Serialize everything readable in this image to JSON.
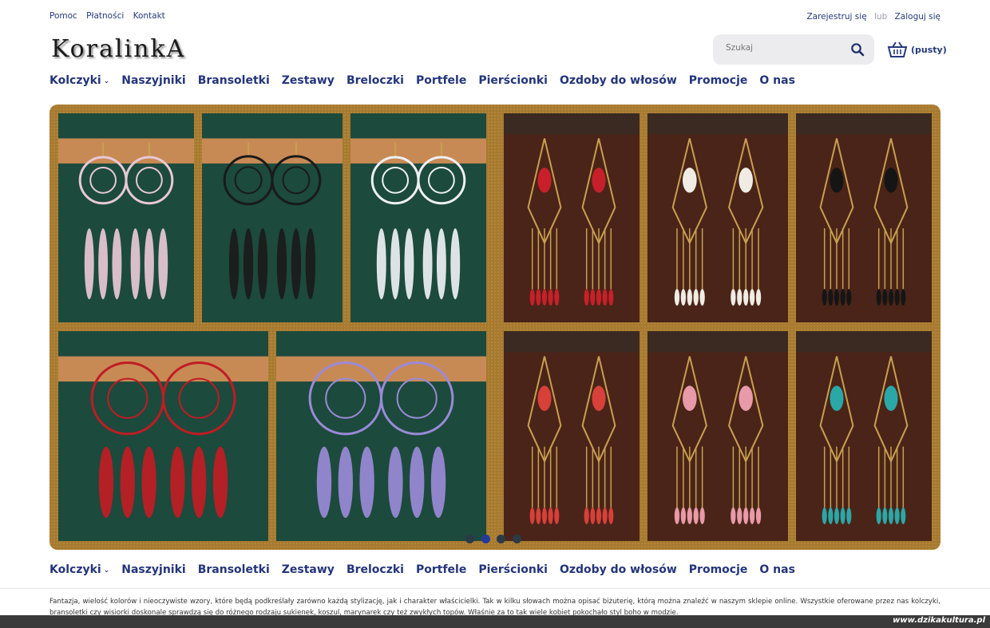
{
  "top_links": {
    "left": [
      "Pomoc",
      "Płatności",
      "Kontakt"
    ],
    "register": "Zarejestruj się",
    "or": "lub",
    "login": "Zaloguj się"
  },
  "logo": {
    "text": "KoralinkA"
  },
  "search": {
    "placeholder": "Szukaj",
    "icon": "search-icon"
  },
  "cart": {
    "label": "(pusty)",
    "icon": "basket-icon"
  },
  "nav": {
    "items": [
      "Kolczyki",
      "Naszyjniki",
      "Bransoletki",
      "Zestawy",
      "Breloczki",
      "Portfele",
      "Pierścionki",
      "Ozdoby do włosów",
      "Promocje",
      "O nas"
    ],
    "dropdown_icon": "chevron-down-icon"
  },
  "slider": {
    "tiles": [
      {
        "name": "dreamcatcher-earrings-pink",
        "color": "#e8c8d6",
        "bg": "#1c4a3c",
        "style": "dream"
      },
      {
        "name": "dreamcatcher-earrings-black",
        "color": "#1a1a1a",
        "bg": "#1c4a3c",
        "style": "dream"
      },
      {
        "name": "dreamcatcher-earrings-white",
        "color": "#eef0f4",
        "bg": "#1c4a3c",
        "style": "dream"
      },
      {
        "name": "chandelier-earrings-red",
        "color": "#c8202a",
        "bg": "#4a2418",
        "style": "chand"
      },
      {
        "name": "chandelier-earrings-white",
        "color": "#f0ece4",
        "bg": "#4a2418",
        "style": "chand"
      },
      {
        "name": "chandelier-earrings-black",
        "color": "#151515",
        "bg": "#4a2418",
        "style": "chand"
      },
      {
        "name": "dreamcatcher-earrings-red",
        "color": "#c01c24",
        "bg": "#1c4a3c",
        "style": "dream"
      },
      {
        "name": "dreamcatcher-earrings-purple",
        "color": "#9a8ad8",
        "bg": "#1c4a3c",
        "style": "dream"
      },
      {
        "name": "chandelier-earrings-multicolor",
        "color": "#d8403a",
        "bg": "#4a2418",
        "style": "chand"
      },
      {
        "name": "chandelier-earrings-pink",
        "color": "#e89aa8",
        "bg": "#4a2418",
        "style": "chand"
      },
      {
        "name": "chandelier-earrings-turquoise",
        "color": "#2aa8a8",
        "bg": "#4a2418",
        "style": "chand"
      }
    ],
    "dots": 4,
    "active_dot": 1
  },
  "description": "Fantazja, wielość kolorów i nieoczywiste wzory, które będą podkreślały zarówno każdą stylizację, jak i charakter właścicielki. Tak w kilku słowach można opisać biżuterię, którą można znaleźć w naszym sklepie online. Wszystkie oferowane przez nas kolczyki, bransoletki czy wisiorki doskonale sprawdzą się do różnego rodzaju sukienek, koszul, marynarek czy też zwykłych topów. Właśnie za to tak wiele kobiet pokochało styl boho w modzie.",
  "watermark": "www.dzikakultura.pl"
}
